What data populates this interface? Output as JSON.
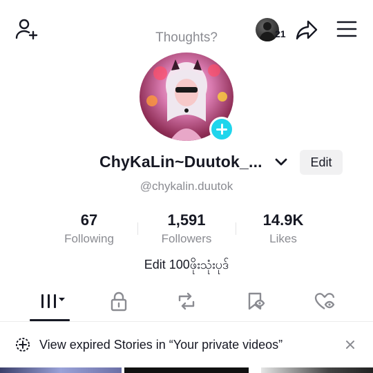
{
  "header": {
    "thoughts_placeholder": "Thoughts?",
    "friends_count": "21"
  },
  "icons": {
    "add_friend": "person-add-icon",
    "share": "share-arrow-icon",
    "menu": "hamburger-menu-icon",
    "chevron": "chevron-down-icon",
    "add_story": "plus-icon"
  },
  "profile": {
    "display_name": "ChyKaLin~Duutok_...",
    "handle": "@chykalin.duutok",
    "edit_label": "Edit",
    "bio": "Edit 100ဖိုးသုံးပုဒ်"
  },
  "stats": [
    {
      "value": "67",
      "label": "Following"
    },
    {
      "value": "1,591",
      "label": "Followers"
    },
    {
      "value": "14.9K",
      "label": "Likes"
    }
  ],
  "tabs": [
    {
      "name": "videos-grid",
      "icon": "grid-bars-icon",
      "active": true
    },
    {
      "name": "private",
      "icon": "lock-icon",
      "active": false
    },
    {
      "name": "reposts",
      "icon": "repost-icon",
      "active": false
    },
    {
      "name": "saved",
      "icon": "bookmark-icon",
      "active": false
    },
    {
      "name": "liked",
      "icon": "heart-icon",
      "active": false
    }
  ],
  "banner": {
    "text": "View expired Stories in “Your private videos”"
  },
  "colors": {
    "accent_cyan": "#20d5ec",
    "text_primary": "#161823",
    "text_secondary": "#8a8b91",
    "button_bg": "#f1f1f2"
  }
}
